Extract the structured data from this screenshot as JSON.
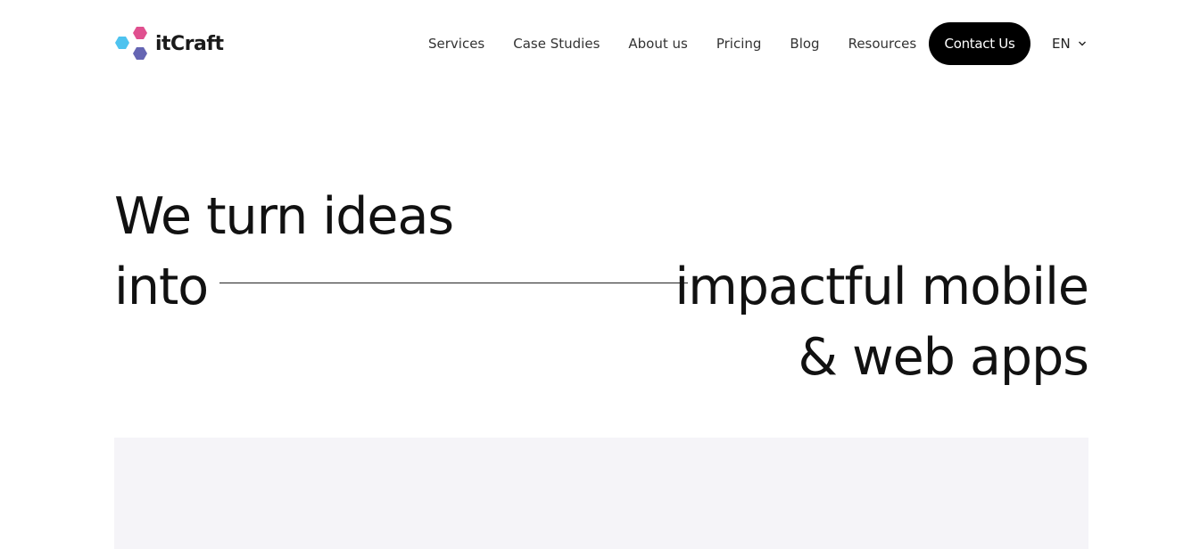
{
  "brand": {
    "name": "itCraft",
    "colors": {
      "pink": "#e0508f",
      "cyan": "#4ec3ef",
      "purple": "#6565b3"
    }
  },
  "nav": {
    "items": [
      {
        "label": "Services"
      },
      {
        "label": "Case Studies"
      },
      {
        "label": "About us"
      },
      {
        "label": "Pricing"
      },
      {
        "label": "Blog"
      },
      {
        "label": "Resources"
      }
    ],
    "contact_label": "Contact Us",
    "language": "EN"
  },
  "hero": {
    "line1": "We turn ideas",
    "line2_left": "into",
    "line2_right": "impactful mobile",
    "line3": "& web apps"
  },
  "colors": {
    "background": "#ffffff",
    "text": "#111111",
    "button_bg": "#000000",
    "button_text": "#ffffff",
    "media_bg": "#f5f4f8"
  }
}
